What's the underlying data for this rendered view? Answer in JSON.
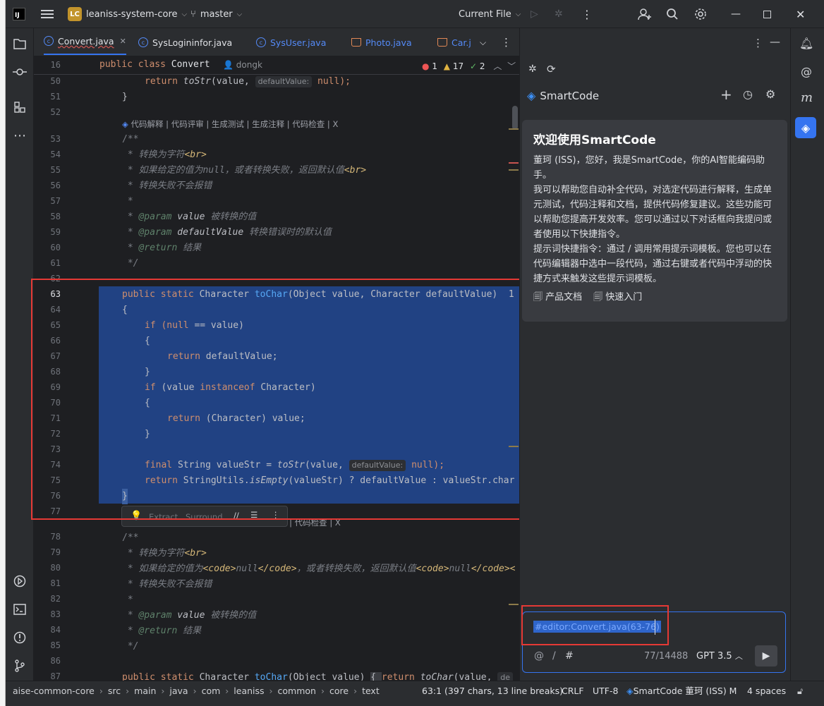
{
  "titlebar": {
    "logo": "IJ",
    "project_badge": "LC",
    "project": "leaniss-system-core",
    "branch": "master",
    "run_config": "Current File"
  },
  "tabs": [
    {
      "label": "Convert.java",
      "active": true
    },
    {
      "label": "SysLogininfor.java"
    },
    {
      "label": "SysUser.java"
    },
    {
      "label": "Photo.java"
    },
    {
      "label": "Car.j"
    }
  ],
  "editor": {
    "sticky": {
      "line": "16",
      "code_kw": "public class",
      "code_name": "Convert",
      "author": "dongk",
      "errors": "1",
      "warnings": "17",
      "checks": "2"
    },
    "ai_actions": "代码解释 | 代码评审 | 生成测试 | 生成注释 | 代码检查 | X",
    "ai_actions_partial": "释 | 代码检查 | X",
    "popup": {
      "extract": "Extract",
      "surround": "Surround"
    },
    "lines": [
      "50",
      "51",
      "52",
      "53",
      "54",
      "55",
      "56",
      "57",
      "58",
      "59",
      "60",
      "61",
      "62",
      "63",
      "64",
      "65",
      "66",
      "67",
      "68",
      "69",
      "70",
      "71",
      "72",
      "73",
      "74",
      "75",
      "76",
      "77",
      "78",
      "79",
      "80",
      "81",
      "82",
      "83",
      "84",
      "85",
      "86",
      "87"
    ],
    "code": {
      "l50_ret": "return ",
      "l50_fn": "toStr",
      "l50_a": "(value, ",
      "l50_hint": "defaultValue:",
      "l50_b": " null);",
      "l51": "}",
      "l53": "/**",
      "l54a": " * 转换为字符",
      "l54b": "<br>",
      "l55a": " * 如果给定的值为null，或者转换失败，返回默认值",
      "l55b": "<br>",
      "l56": " * 转换失败不会报错",
      "l57": " *",
      "l58a": " * ",
      "l58b": "@param",
      "l58c": " value ",
      "l58d": "被转换的值",
      "l59a": " * ",
      "l59b": "@param",
      "l59c": " defaultValue ",
      "l59d": "转换错误时的默认值",
      "l60a": " * ",
      "l60b": "@return",
      "l60c": " 结果",
      "l61": " */",
      "l63a": "public static ",
      "l63b": "Character ",
      "l63c": "toChar",
      "l63d": "(Object value, Character defaultValue)",
      "l63e": "  1",
      "l64": "{",
      "l65a": "if ",
      "l65b": "(null",
      "l65c": " == value)",
      "l66": "{",
      "l67a": "return ",
      "l67b": "defaultValue;",
      "l68": "}",
      "l69a": "if ",
      "l69b": "(value ",
      "l69c": "instanceof ",
      "l69d": "Character)",
      "l70": "{",
      "l71a": "return ",
      "l71b": "(Character) value;",
      "l72": "}",
      "l74a": "final ",
      "l74b": "String valueStr = ",
      "l74c": "toStr",
      "l74d": "(value, ",
      "l74e": "defaultValue:",
      "l74f": " null);",
      "l75a": "return ",
      "l75b": "StringUtils.",
      "l75c": "isEmpty",
      "l75d": "(valueStr) ? defaultValue : valueStr.char",
      "l76": "}",
      "l78": "/**",
      "l79a": " * 转换为字符",
      "l79b": "<br>",
      "l80a": " * 如果给定的值为",
      "l80b": "<code>",
      "l80c": "null",
      "l80d": "</code>",
      "l80e": "，或者转换失败，返回默认值",
      "l80f": "<code>",
      "l80g": "null",
      "l80h": "</code>",
      "l80i": "<",
      "l81": " * 转换失败不会报错",
      "l82": " *",
      "l83a": " * ",
      "l83b": "@param",
      "l83c": " value ",
      "l83d": "被转换的值",
      "l84a": " * ",
      "l84b": "@return",
      "l84c": " 结果",
      "l85": " */",
      "l87a": "public static ",
      "l87b": "Character ",
      "l87c": "toChar",
      "l87d": "(Object value) ",
      "l87e": "{ ",
      "l87f": "return ",
      "l87g": "toChar",
      "l87h": "(value, ",
      "l87i": "de"
    }
  },
  "smartcode": {
    "title": "SmartCode",
    "welcome_title": "欢迎使用SmartCode",
    "p1": "董珂 (ISS)，您好，我是SmartCode，你的AI智能编码助手。",
    "p2": "我可以帮助您自动补全代码，对选定代码进行解释，生成单元测试，代码注释和文档，提供代码修复建议。这些功能可以帮助您提高开发效率。您可以通过以下对话框向我提问或者使用以下快捷指令。",
    "p3": "提示词快捷指令：通过 / 调用常用提示词模板。您也可以在代码编辑器中选中一段代码，通过右键或者代码中浮动的快捷方式来触发这些提示词模板。",
    "doc_link": "产品文档",
    "quick_link": "快速入门",
    "input_value": "#editor:Convert.java(63-76)",
    "at": "@",
    "slash": "/",
    "hash": "#",
    "count": "77/14488",
    "model": "GPT 3.5"
  },
  "statusbar": {
    "path": [
      "aise-common-core",
      "src",
      "main",
      "java",
      "com",
      "leaniss",
      "common",
      "core",
      "text"
    ],
    "position": "63:1 (397 chars, 13 line breaks)",
    "line_sep": "CRLF",
    "encoding": "UTF-8",
    "plugin": "SmartCode 董珂 (ISS) M",
    "indent": "4 spaces"
  }
}
